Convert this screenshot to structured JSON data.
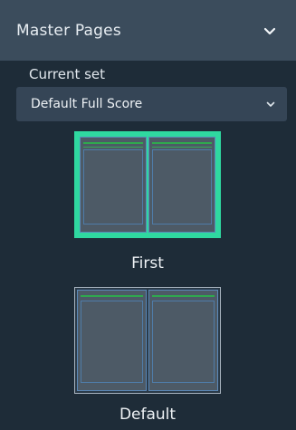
{
  "panel": {
    "title": "Master Pages"
  },
  "current_set": {
    "label": "Current set",
    "value": "Default Full Score"
  },
  "master_pages": [
    {
      "name": "First",
      "selected": true
    },
    {
      "name": "Default",
      "selected": false
    }
  ],
  "colors": {
    "accent_selected": "#2fd8a0",
    "header_bg": "#3b4c5c",
    "panel_bg": "#1e2c38"
  },
  "icons": {
    "panel_collapse": "chevron-down-icon",
    "select_open": "chevron-down-icon"
  }
}
